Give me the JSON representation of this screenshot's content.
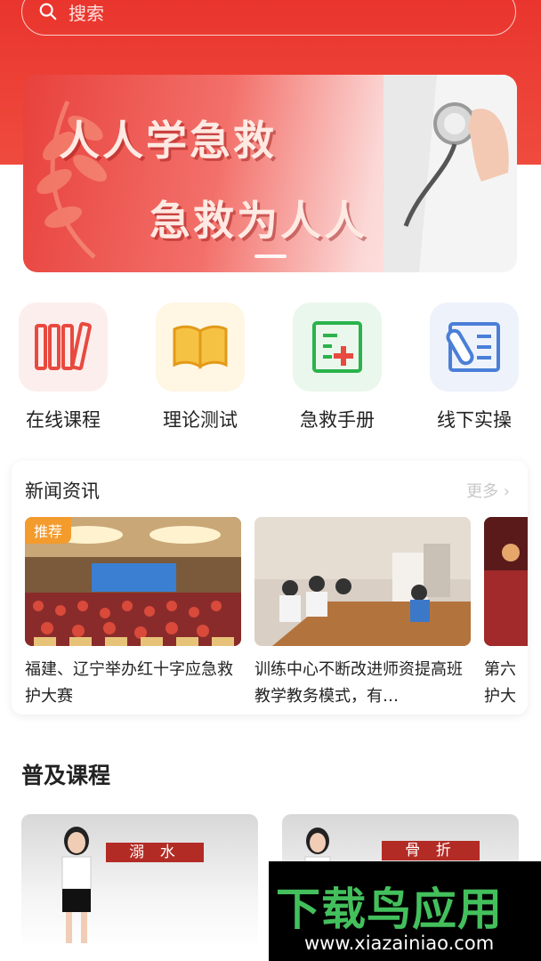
{
  "search": {
    "placeholder": "搜索"
  },
  "banner": {
    "line1": "人人学急救",
    "line2": "急救为人人"
  },
  "quick_entries": [
    {
      "label": "在线课程",
      "icon": "books-icon",
      "color": "#e84a3f"
    },
    {
      "label": "理论测试",
      "icon": "open-book-icon",
      "color": "#f0a21e"
    },
    {
      "label": "急救手册",
      "icon": "medical-manual-icon",
      "color": "#2bb24c"
    },
    {
      "label": "线下实操",
      "icon": "bandage-checklist-icon",
      "color": "#4a7fd8"
    }
  ],
  "news": {
    "title": "新闻资讯",
    "more": "更多 ›",
    "items": [
      {
        "tag": "推荐",
        "title": "福建、辽宁举办红十字应急救护大赛"
      },
      {
        "title": "训练中心不断改进师资提高班教学教务模式，有…"
      },
      {
        "title": "第六护大"
      }
    ]
  },
  "courses": {
    "title": "普及课程",
    "items": [
      {
        "label": "溺 水"
      },
      {
        "label": "骨 折"
      }
    ]
  },
  "watermark": {
    "logo": "下载鸟应用",
    "url": "www.xiazainiao.com"
  }
}
